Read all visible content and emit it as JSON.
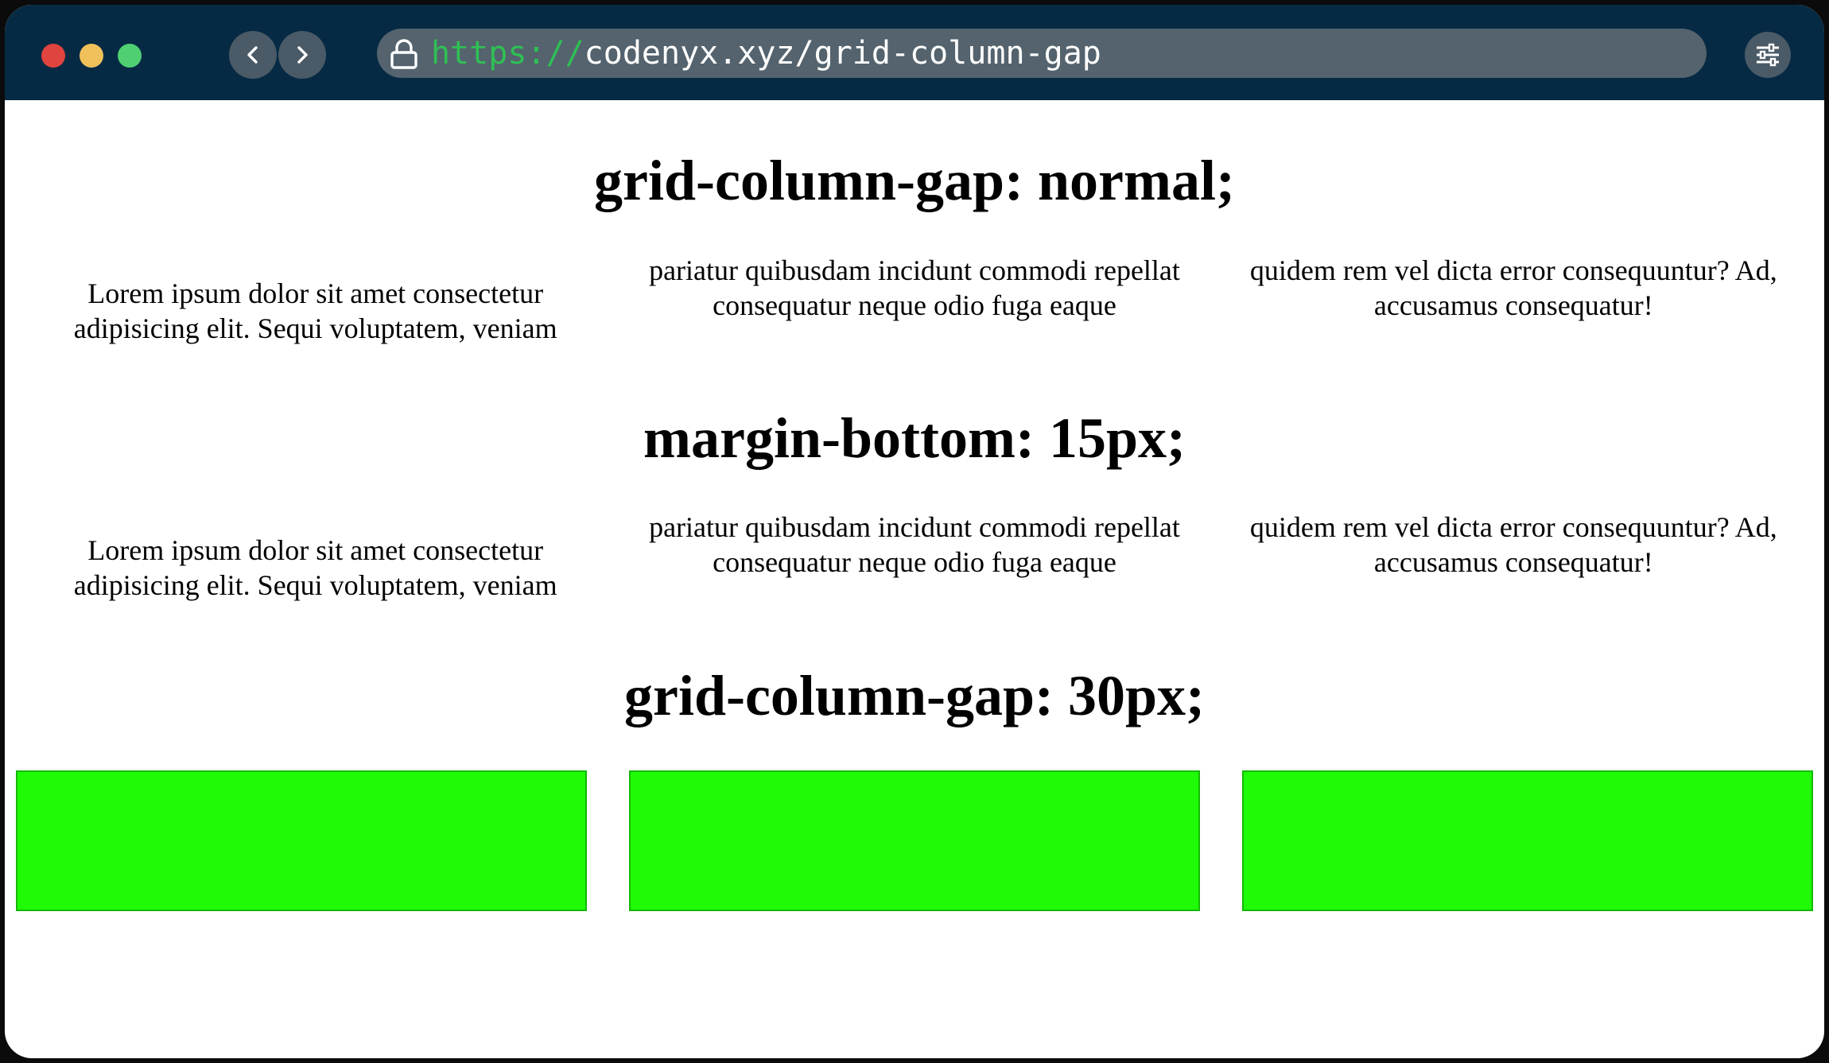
{
  "browser": {
    "url_scheme": "https://",
    "url_rest": "codenyx.xyz/grid-column-gap",
    "colors": {
      "titlebar": "#062a44",
      "urlbar": "#54636d",
      "scheme": "#2fbf55"
    },
    "icons": [
      "lock-icon",
      "chevron-left-icon",
      "chevron-right-icon",
      "sliders-icon"
    ]
  },
  "sections": [
    {
      "heading": "grid-column-gap: normal;",
      "cells": [
        "Lorem ipsum dolor sit amet consectetur adipisicing elit. Sequi voluptatem, veniam",
        "pariatur quibusdam incidunt commodi repellat consequatur neque odio fuga eaque",
        "quidem rem vel dicta error consequuntur? Ad, accusamus consequatur!"
      ]
    },
    {
      "heading": "margin-bottom: 15px;",
      "cells": [
        "Lorem ipsum dolor sit amet consectetur adipisicing elit. Sequi voluptatem, veniam",
        "pariatur quibusdam incidunt commodi repellat consequatur neque odio fuga eaque",
        "quidem rem vel dicta error consequuntur? Ad, accusamus consequatur!"
      ]
    },
    {
      "heading": "grid-column-gap: 30px;",
      "box_color": "#1ffb06"
    }
  ]
}
